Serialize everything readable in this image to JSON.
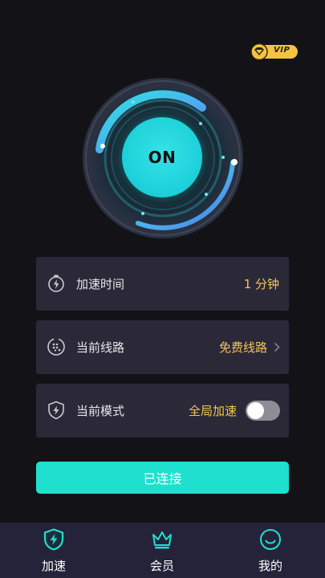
{
  "vip_badge": {
    "label": "VIP"
  },
  "power_button": {
    "label": "ON"
  },
  "info_cards": {
    "time": {
      "label": "加速时间",
      "value": "1 分钟",
      "icon": "timer-bolt-icon"
    },
    "route": {
      "label": "当前线路",
      "value": "免费线路",
      "icon": "route-globe-icon"
    },
    "mode": {
      "label": "当前模式",
      "value": "全局加速",
      "icon": "shield-bolt-icon",
      "toggle_on": false
    }
  },
  "connect_button": {
    "label": "已连接"
  },
  "tabbar": {
    "items": [
      {
        "label": "加速",
        "icon": "shield-bolt-icon",
        "active": true
      },
      {
        "label": "会员",
        "icon": "crown-icon",
        "active": false
      },
      {
        "label": "我的",
        "icon": "smiley-icon",
        "active": false
      }
    ]
  },
  "colors": {
    "background": "#131217",
    "card": "#2b2938",
    "accent": "#1fe0cf",
    "value_text": "#f4c654",
    "tabbar": "#24233a",
    "vip_gold": "#f5c342"
  }
}
